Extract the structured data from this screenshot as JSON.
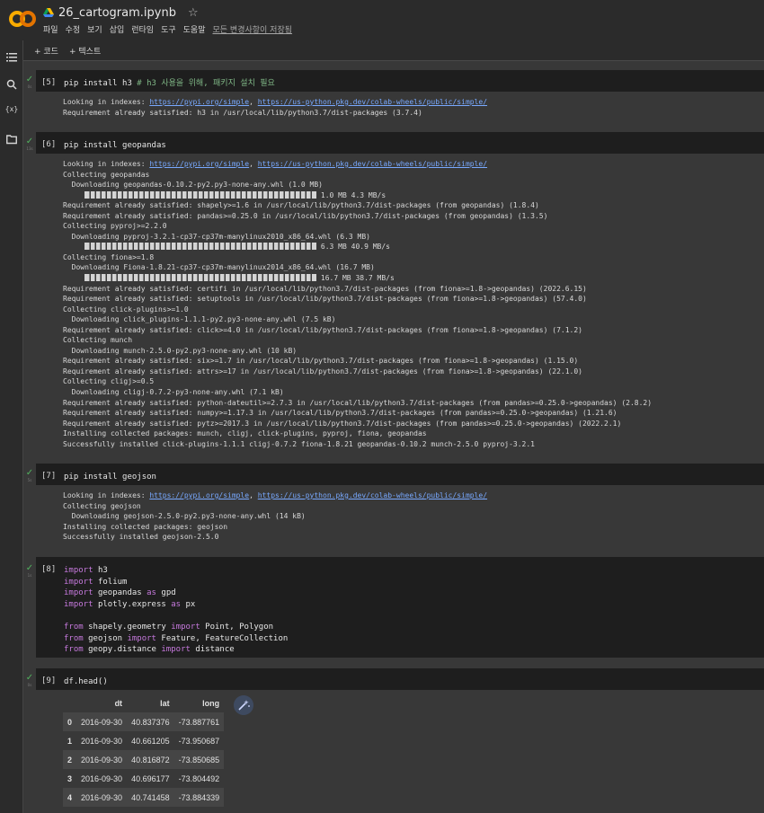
{
  "notebook": {
    "title": "26_cartogram.ipynb"
  },
  "menu": [
    "파일",
    "수정",
    "보기",
    "삽입",
    "런타임",
    "도구",
    "도움말"
  ],
  "save_status": "모든 변경사항이 저장됨",
  "toolbar": {
    "add_code": "+ 코드",
    "add_text": "+ 텍스트"
  },
  "icons": [
    "colab-logo-icon",
    "drive-icon",
    "star-icon",
    "toc-icon",
    "search-icon",
    "variables-icon",
    "folder-icon",
    "check-icon",
    "magic-wand-icon"
  ],
  "colors": {
    "code_bg": "#1e1e1e",
    "output_bg": "#383838",
    "keyword": "#c679dd",
    "comment": "#7fb685",
    "link": "#78a9ff",
    "check": "#51b35e"
  },
  "cells": [
    {
      "exec": "[5]",
      "code": "pip install h3 ",
      "comment": "# h3 사용을 위해, 패키지 설치 필요",
      "output": [
        "Requirement already satisfied: h3 in /usr/local/lib/python3.7/dist-packages (3.7.4)"
      ]
    },
    {
      "exec": "[6]",
      "code": "pip install geopandas",
      "output": [
        "Collecting geopandas",
        "  Downloading geopandas-0.10.2-py2.py3-none-any.whl (1.0 MB)",
        " 1.0 MB 4.3 MB/s",
        "Requirement already satisfied: shapely>=1.6 in /usr/local/lib/python3.7/dist-packages (from geopandas) (1.8.4)",
        "Requirement already satisfied: pandas>=0.25.0 in /usr/local/lib/python3.7/dist-packages (from geopandas) (1.3.5)",
        "Collecting pyproj>=2.2.0",
        "  Downloading pyproj-3.2.1-cp37-cp37m-manylinux2010_x86_64.whl (6.3 MB)",
        " 6.3 MB 40.9 MB/s",
        "Collecting fiona>=1.8",
        "  Downloading Fiona-1.8.21-cp37-cp37m-manylinux2014_x86_64.whl (16.7 MB)",
        " 16.7 MB 38.7 MB/s",
        "Requirement already satisfied: certifi in /usr/local/lib/python3.7/dist-packages (from fiona>=1.8->geopandas) (2022.6.15)",
        "Requirement already satisfied: setuptools in /usr/local/lib/python3.7/dist-packages (from fiona>=1.8->geopandas) (57.4.0)",
        "Collecting click-plugins>=1.0",
        "  Downloading click_plugins-1.1.1-py2.py3-none-any.whl (7.5 kB)",
        "Requirement already satisfied: click>=4.0 in /usr/local/lib/python3.7/dist-packages (from fiona>=1.8->geopandas) (7.1.2)",
        "Collecting munch",
        "  Downloading munch-2.5.0-py2.py3-none-any.whl (10 kB)",
        "Requirement already satisfied: six>=1.7 in /usr/local/lib/python3.7/dist-packages (from fiona>=1.8->geopandas) (1.15.0)",
        "Requirement already satisfied: attrs>=17 in /usr/local/lib/python3.7/dist-packages (from fiona>=1.8->geopandas) (22.1.0)",
        "Collecting cligj>=0.5",
        "  Downloading cligj-0.7.2-py3-none-any.whl (7.1 kB)",
        "Requirement already satisfied: python-dateutil>=2.7.3 in /usr/local/lib/python3.7/dist-packages (from pandas>=0.25.0->geopandas) (2.8.2)",
        "Requirement already satisfied: numpy>=1.17.3 in /usr/local/lib/python3.7/dist-packages (from pandas>=0.25.0->geopandas) (1.21.6)",
        "Requirement already satisfied: pytz>=2017.3 in /usr/local/lib/python3.7/dist-packages (from pandas>=0.25.0->geopandas) (2022.2.1)",
        "Installing collected packages: munch, cligj, click-plugins, pyproj, fiona, geopandas",
        "Successfully installed click-plugins-1.1.1 cligj-0.7.2 fiona-1.8.21 geopandas-0.10.2 munch-2.5.0 pyproj-3.2.1"
      ]
    },
    {
      "exec": "[7]",
      "code": "pip install geojson",
      "output": [
        "Collecting geojson",
        "  Downloading geojson-2.5.0-py2.py3-none-any.whl (14 kB)",
        "Installing collected packages: geojson",
        "Successfully installed geojson-2.5.0"
      ]
    },
    {
      "exec": "[8]",
      "code": [
        "import h3",
        "import folium",
        "import geopandas as gpd",
        "import plotly.express as px",
        "from shapely.geometry import Point, Polygon",
        "from geojson import Feature, FeatureCollection",
        "from geopy.distance import distance"
      ]
    },
    {
      "exec": "[9]",
      "code": "df.head()"
    }
  ],
  "pip_index": {
    "prefix": "Looking in indexes: ",
    "url1": "https://pypi.org/simple",
    "sep": ", ",
    "url2": "https://us-python.pkg.dev/colab-wheels/public/simple/"
  },
  "dataframe": {
    "columns": [
      "",
      "dt",
      "lat",
      "long"
    ],
    "rows": [
      [
        "0",
        "2016-09-30",
        "40.837376",
        "-73.887761"
      ],
      [
        "1",
        "2016-09-30",
        "40.661205",
        "-73.950687"
      ],
      [
        "2",
        "2016-09-30",
        "40.816872",
        "-73.850685"
      ],
      [
        "3",
        "2016-09-30",
        "40.696177",
        "-73.804492"
      ],
      [
        "4",
        "2016-09-30",
        "40.741458",
        "-73.884339"
      ]
    ]
  }
}
